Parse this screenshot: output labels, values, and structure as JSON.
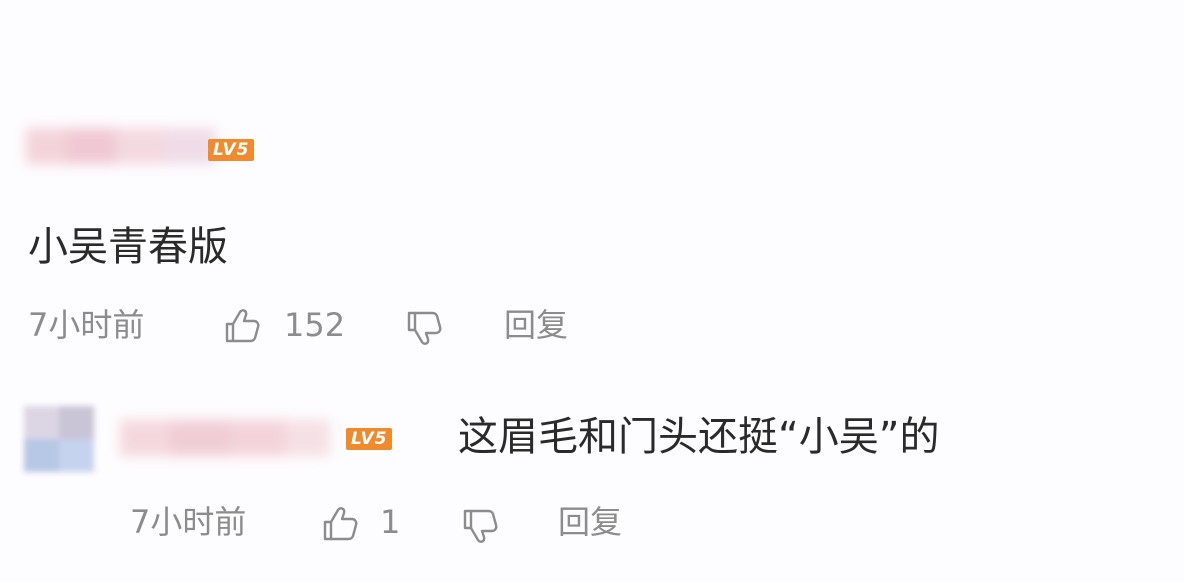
{
  "comment": {
    "level_badge": "LV5",
    "text": "小吴青春版",
    "time": "7小时前",
    "likes": "152",
    "reply_label": "回复"
  },
  "reply": {
    "level_badge": "LV5",
    "text": "这眉毛和门头还挺“小吴”的",
    "time": "7小时前",
    "likes": "1",
    "reply_label": "回复"
  },
  "icons": {
    "like": "thumbs-up-icon",
    "dislike": "thumbs-down-icon"
  },
  "colors": {
    "badge": "#f08a2c",
    "meta_text": "#8c8c8c",
    "main_text": "#2a2a2a",
    "background": "#fdfcfe"
  }
}
